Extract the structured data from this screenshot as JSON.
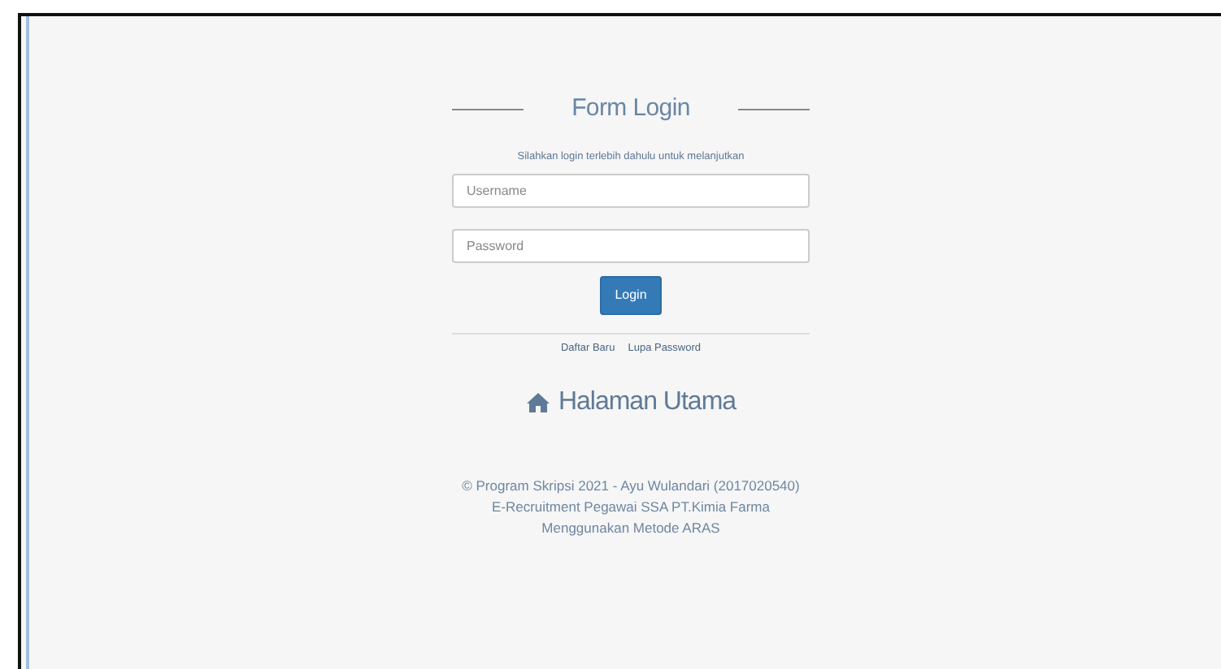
{
  "title": "Form Login",
  "subtitle": "Silahkan login terlebih dahulu untuk melanjutkan",
  "fields": [
    {
      "placeholder": "Username"
    },
    {
      "placeholder": "Password"
    }
  ],
  "button": "Login",
  "links": [
    "Daftar Baru",
    "Lupa Password"
  ],
  "home_link": "Halaman Utama",
  "footer": [
    "© Program Skripsi 2021 - Ayu Wulandari (2017020540)",
    "E-Recruitment Pegawai SSA PT.Kimia Farma",
    "Menggunakan Metode ARAS"
  ]
}
